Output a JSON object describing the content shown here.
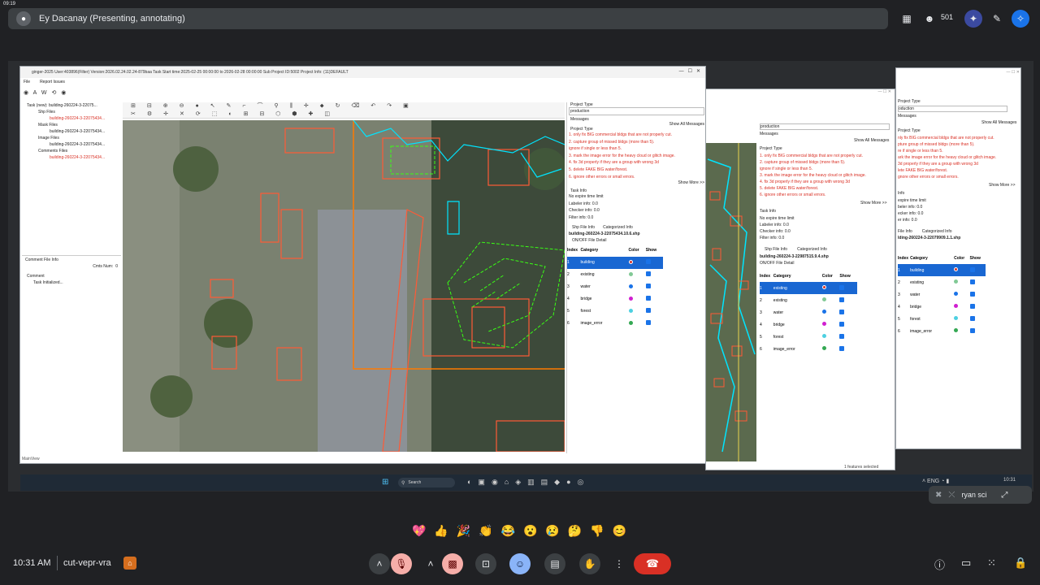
{
  "meet": {
    "presenter_label": "Ey Dacanay (Presenting, annotating)",
    "participant_count": "501",
    "clock": "10:31 AM",
    "meeting_code": "cut-vepr-vra",
    "self_tile_name": "ryan sci",
    "reactions": [
      "💖",
      "👍",
      "🎉",
      "👏",
      "😂",
      "😮",
      "😢",
      "🤔",
      "👎",
      "😊"
    ]
  },
  "app_main": {
    "title": "ginger-2025   User:403896(Filter)   Version:2026.02.24.02.24-879baa   Task Start time:2025-02-25 00:00:00 to 2026-02-28 00:00:00   Sub Project ID:5002   Project Info: (11)DEFAULT",
    "menu": [
      "File",
      "Report Issues"
    ],
    "tree": {
      "root": "Task (new): building-260224-3-22075...",
      "shp_files": "Shp Files",
      "shp_item": "building-260224-3-22075434...",
      "mask_files": "Mask Files",
      "mask_item": "building-260224-3-22075434...",
      "image_files": "Image Files",
      "image_item": "building-260224-3-22075434...",
      "comments_files": "Comments Files",
      "comments_item": "building-260224-3-22075434..."
    },
    "comment_panel": {
      "title": "Comment File Info",
      "cmts_num_label": "Cmts Num:",
      "cmts_num": "0",
      "comment_label": "Comment",
      "task_initialized": "Task Initialized..."
    },
    "status": "MainView",
    "project_type_label": "Project Type",
    "project_type_value": "production",
    "messages_label": "Messages",
    "show_all_messages": "Show All Messages",
    "project_type_label2": "Project Type",
    "instructions": [
      "1. only fix BIG commercial bldgs that are not properly cut.",
      "2. capture group of missed bldgs (more than 5).",
      "ignore if single or less than 5.",
      "3. mark the image error for the heavy cloud or glitch image.",
      "4. fix 3d properly if they are a group with wrong 3d",
      "5. delete FAKE BIG water/forest.",
      "6. ignore other errors or small errors."
    ],
    "show_more": "Show More >>",
    "task_info_label": "Task Info",
    "task_info": [
      "No expire time limit",
      "Labeler info: 0.0",
      "Checker info: 0.0",
      "Filter info: 0.0"
    ],
    "tabs": [
      "Shp File Info",
      "Categorized Info"
    ],
    "shp_filename": "building-260224-3-22075434.10.6.shp",
    "onoff_label": "ON/OFF File Detail",
    "table_headers": [
      "Index",
      "Category",
      "Color",
      "Show"
    ],
    "categories": [
      {
        "index": "1",
        "name": "building",
        "color": "#d93025"
      },
      {
        "index": "2",
        "name": "existing",
        "color": "#81c995"
      },
      {
        "index": "3",
        "name": "water",
        "color": "#1a73e8"
      },
      {
        "index": "4",
        "name": "bridge",
        "color": "#d01fd0"
      },
      {
        "index": "5",
        "name": "forest",
        "color": "#4dd0e1"
      },
      {
        "index": "6",
        "name": "image_error",
        "color": "#34a853"
      }
    ]
  },
  "app_mid": {
    "project_type_value": "production",
    "messages_label": "Messages",
    "show_all_messages": "Show All Messages",
    "project_type_label": "Project Type",
    "instructions": [
      "1. only fix BIG commercial bldgs that are not properly cut.",
      "2. capture group of missed bldgs (more than 5).",
      "ignore if single or less than 5.",
      "3. mark the image error for the heavy cloud or glitch image.",
      "4. fix 3d properly if they are a group with wrong 3d",
      "5. delete FAKE BIG water/forest.",
      "6. ignore other errors or small errors."
    ],
    "show_more": "Show More >>",
    "task_info_label": "Task Info",
    "task_info": [
      "No expire time limit",
      "Labeler info: 0.0",
      "Checker info: 0.0",
      "Filter info: 0.0"
    ],
    "tabs": [
      "Shp File Info",
      "Categorized Info"
    ],
    "shp_filename": "building-260224-3-22987515.9.4.shp",
    "onoff_label": "ON/OFF File Detail",
    "table_headers": [
      "Index",
      "Category",
      "Color",
      "Show"
    ],
    "categories": [
      {
        "index": "1",
        "name": "existing",
        "color": "#d93025"
      },
      {
        "index": "2",
        "name": "existing",
        "color": "#81c995"
      },
      {
        "index": "3",
        "name": "water",
        "color": "#1a73e8"
      },
      {
        "index": "4",
        "name": "bridge",
        "color": "#d01fd0"
      },
      {
        "index": "5",
        "name": "forest",
        "color": "#4dd0e1"
      },
      {
        "index": "6",
        "name": "image_error",
        "color": "#34a853"
      }
    ],
    "status": "1 features selected"
  },
  "app_right": {
    "project_type_value": "oduction",
    "messages_label": "Messages",
    "show_all_messages": "Show All Messages",
    "project_type_label": "Project Type",
    "instructions": [
      "nly fix BIG commercial bldgs that are not properly cut.",
      "pture group of missed bldgs (more than 5).",
      "re if single or less than 5.",
      "ark the image error for the heavy cloud or glitch image.",
      "3d properly if they are a group with wrong 3d",
      "lete FAKE BIG water/forest.",
      "gnore other errors or small errors."
    ],
    "show_more": "Show More >>",
    "task_info_label": "Info",
    "task_info": [
      "expire time limit",
      "beler info: 0.0",
      "ecker info: 0.0",
      "er info: 0.0"
    ],
    "tabs": [
      "File Info",
      "Categorized Info"
    ],
    "shp_filename": "lding-260224-3-22079909.1.1.shp",
    "table_headers": [
      "Index",
      "Category",
      "Color",
      "Show"
    ],
    "categories": [
      {
        "index": "1",
        "name": "building",
        "color": "#d93025"
      },
      {
        "index": "2",
        "name": "existing",
        "color": "#81c995"
      },
      {
        "index": "3",
        "name": "water",
        "color": "#1a73e8"
      },
      {
        "index": "4",
        "name": "bridge",
        "color": "#d01fd0"
      },
      {
        "index": "5",
        "name": "forest",
        "color": "#4dd0e1"
      },
      {
        "index": "6",
        "name": "image_error",
        "color": "#34a853"
      }
    ]
  },
  "taskbar": {
    "search": "Search",
    "time": "10:31"
  }
}
